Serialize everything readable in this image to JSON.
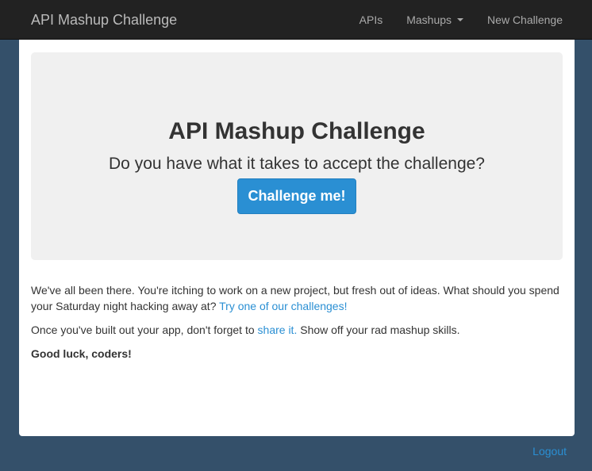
{
  "navbar": {
    "brand": "API Mashup Challenge",
    "items": [
      {
        "label": "APIs"
      },
      {
        "label": "Mashups"
      },
      {
        "label": "New Challenge"
      }
    ]
  },
  "jumbotron": {
    "title": "API Mashup Challenge",
    "lead": "Do you have what it takes to accept the challenge?",
    "button_label": "Challenge me!"
  },
  "content": {
    "p1_text": "We've all been there. You're itching to work on a new project, but fresh out of ideas. What should you spend your Saturday night hacking away at? ",
    "p1_link": "Try one of our challenges!",
    "p2_text_before": "Once you've built out your app, don't forget to ",
    "p2_link": "share it.",
    "p2_text_after": " Show off your rad mashup skills.",
    "p3_text": "Good luck, coders!"
  },
  "footer": {
    "logout": "Logout"
  },
  "colors": {
    "background": "#34506a",
    "navbar": "#222222",
    "accent": "#2a8fd3",
    "jumbotron": "#f0f0f0"
  }
}
